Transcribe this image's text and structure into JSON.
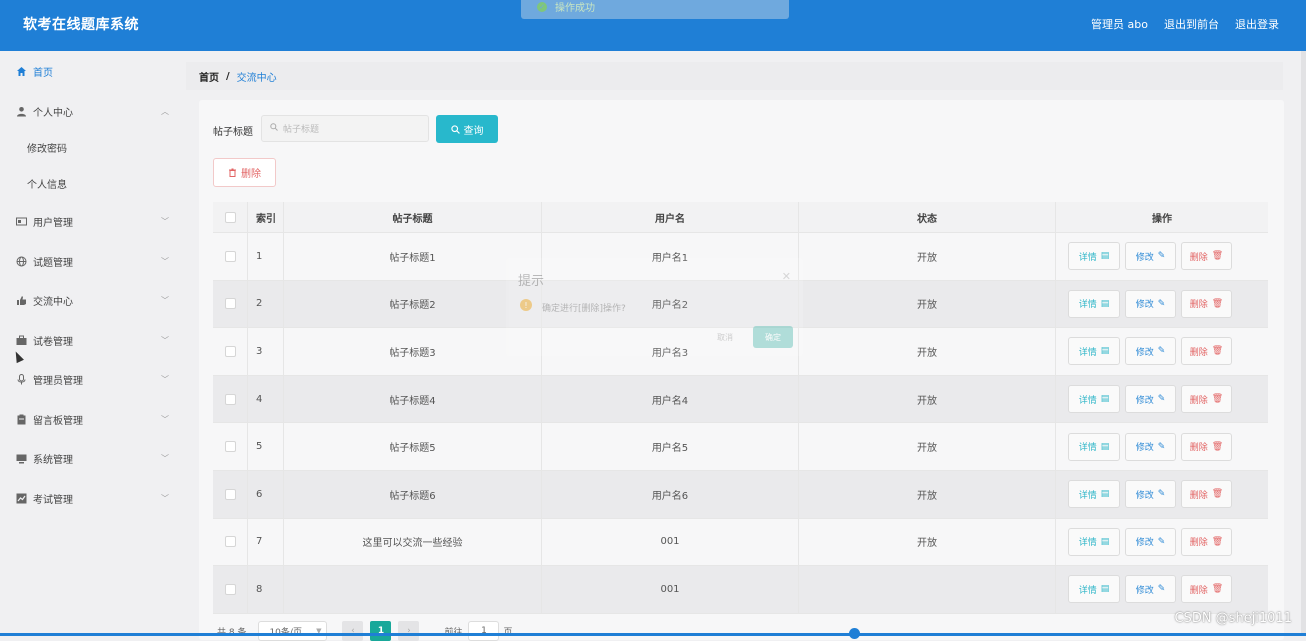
{
  "header": {
    "title": "软考在线题库系统",
    "links": [
      "管理员 abo",
      "退出到前台",
      "退出登录"
    ]
  },
  "toast": {
    "message": "操作成功"
  },
  "sidebar": {
    "items": [
      {
        "label": "首页",
        "icon": "home-icon"
      },
      {
        "label": "个人中心",
        "icon": "user-icon"
      },
      {
        "label": "修改密码"
      },
      {
        "label": "个人信息"
      },
      {
        "label": "用户管理",
        "icon": "id-card-icon"
      },
      {
        "label": "试题管理",
        "icon": "globe-icon"
      },
      {
        "label": "交流中心",
        "icon": "thumb-icon"
      },
      {
        "label": "试卷管理",
        "icon": "briefcase-icon"
      },
      {
        "label": "管理员管理",
        "icon": "mic-icon"
      },
      {
        "label": "留言板管理",
        "icon": "clipboard-icon"
      },
      {
        "label": "系统管理",
        "icon": "monitor-icon"
      },
      {
        "label": "考试管理",
        "icon": "chart-icon"
      }
    ]
  },
  "breadcrumb": {
    "home": "首页",
    "separator": "/",
    "current": "交流中心"
  },
  "search": {
    "label": "帖子标题",
    "placeholder": "帖子标题",
    "query_button": "查询"
  },
  "toolbar": {
    "delete_button": "删除"
  },
  "table": {
    "headers": [
      "索引",
      "帖子标题",
      "用户名",
      "状态",
      "操作"
    ],
    "op_labels": {
      "detail": "详情",
      "edit": "修改",
      "delete": "删除"
    },
    "rows": [
      {
        "index": "1",
        "title": "帖子标题1",
        "user": "用户名1",
        "status": "开放"
      },
      {
        "index": "2",
        "title": "帖子标题2",
        "user": "用户名2",
        "status": "开放"
      },
      {
        "index": "3",
        "title": "帖子标题3",
        "user": "用户名3",
        "status": "开放"
      },
      {
        "index": "4",
        "title": "帖子标题4",
        "user": "用户名4",
        "status": "开放"
      },
      {
        "index": "5",
        "title": "帖子标题5",
        "user": "用户名5",
        "status": "开放"
      },
      {
        "index": "6",
        "title": "帖子标题6",
        "user": "用户名6",
        "status": "开放"
      },
      {
        "index": "7",
        "title": "这里可以交流一些经验",
        "user": "001",
        "status": "开放"
      },
      {
        "index": "8",
        "title": "",
        "user": "001",
        "status": ""
      }
    ]
  },
  "modal": {
    "title": "提示",
    "message": "确定进行[删除]操作?",
    "cancel": "取消",
    "confirm": "确定"
  },
  "pagination": {
    "total": "共 8 条",
    "page_size": "10条/页",
    "current_page": "1",
    "goto_label": "前往",
    "goto_value": "1",
    "page_unit": "页"
  },
  "watermark": "CSDN @sheji1011",
  "colors": {
    "brand": "#1f7fd6",
    "query": "#28b8cc",
    "danger": "#e26363",
    "page_active": "#19a89a"
  }
}
